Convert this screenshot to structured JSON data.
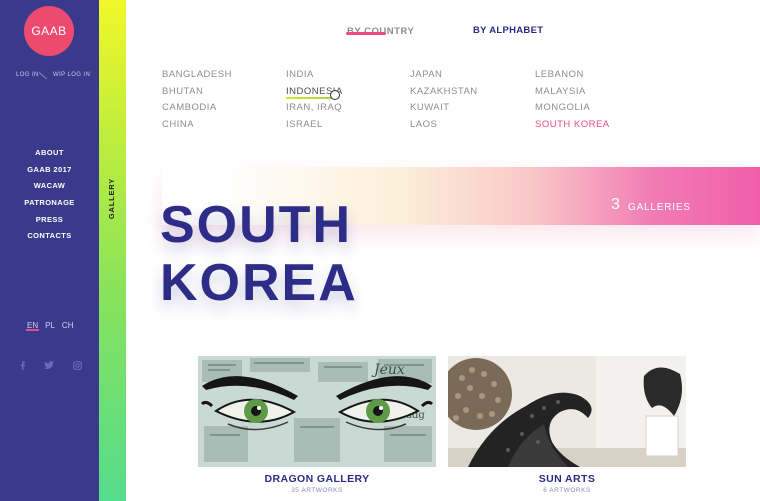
{
  "brand": {
    "logo_text": "GAAB"
  },
  "auth": {
    "login": "LOG IN",
    "wip_login": "WIP LOG IN"
  },
  "menu": [
    "ABOUT",
    "GAAB 2017",
    "WACAW",
    "PATRONAGE",
    "PRESS",
    "CONTACTS"
  ],
  "languages": [
    {
      "label": "EN",
      "active": true
    },
    {
      "label": "PL",
      "active": false
    },
    {
      "label": "CH",
      "active": false
    }
  ],
  "social": {
    "facebook": "facebook-icon",
    "twitter": "twitter-icon",
    "instagram": "instagram-icon"
  },
  "section_label": "GALLERY",
  "tabs": {
    "by_country": "BY COUNTRY",
    "by_alphabet": "BY ALPHABET",
    "active": "BY COUNTRY"
  },
  "countries": [
    "BANGLADESH",
    "BHUTAN",
    "CAMBODIA",
    "CHINA",
    "INDIA",
    "INDONESIA",
    "IRAN, IRAQ",
    "ISRAEL",
    "JAPAN",
    "KAZAKHSTAN",
    "KUWAIT",
    "LAOS",
    "LEBANON",
    "MALAYSIA",
    "MONGOLIA",
    "SOUTH KOREA"
  ],
  "hovered_country": "INDONESIA",
  "selected_country": "SOUTH KOREA",
  "hero": {
    "title_line1": "SOUTH",
    "title_line2": "KOREA",
    "gallery_count": "3",
    "gallery_label": "GALLERIES"
  },
  "galleries": [
    {
      "name": "DRAGON GALLERY",
      "artworks": "35 ARTWORKS"
    },
    {
      "name": "SUN ARTS",
      "artworks": "6 ARTWORKS"
    }
  ],
  "colors": {
    "sidebar": "#3a3a8c",
    "accent_pink": "#ec4a82",
    "navy": "#2d2d87",
    "strip_top": "#f2f72a",
    "strip_bottom": "#55dc8e"
  }
}
